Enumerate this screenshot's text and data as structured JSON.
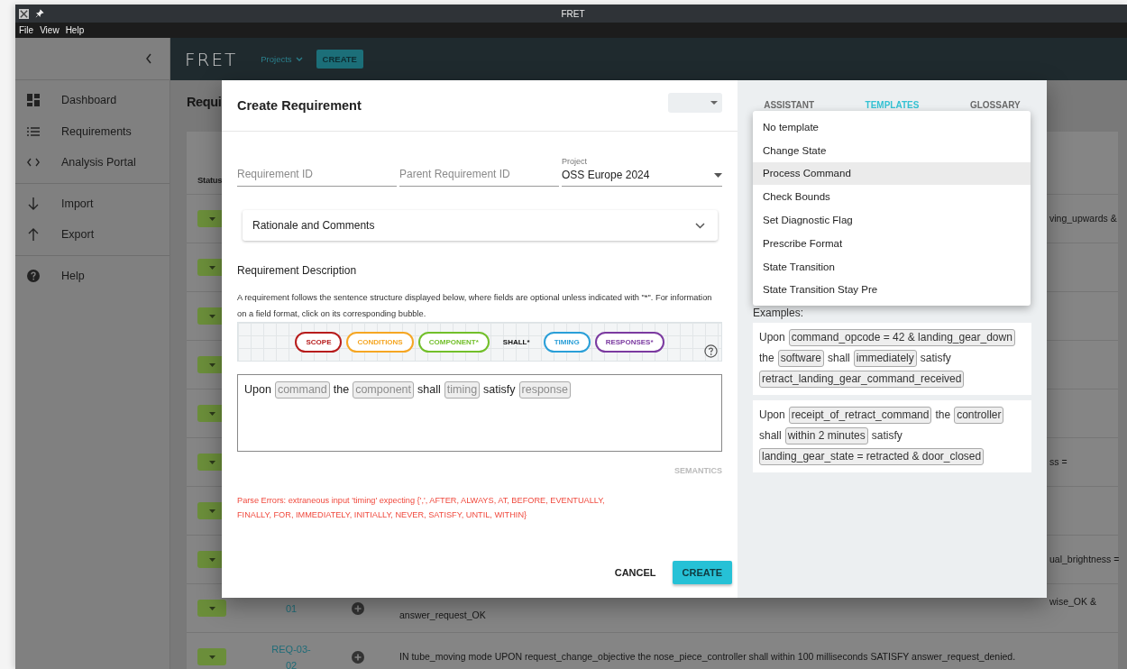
{
  "window": {
    "title": "FRET"
  },
  "menu_bar": [
    {
      "label": "File"
    },
    {
      "label": "View"
    },
    {
      "label": "Help"
    }
  ],
  "sidebar": {
    "groups": [
      {
        "items": [
          {
            "label": "Dashboard"
          },
          {
            "label": "Requirements"
          },
          {
            "label": "Analysis Portal"
          }
        ]
      },
      {
        "items": [
          {
            "label": "Import"
          },
          {
            "label": "Export"
          }
        ]
      },
      {
        "items": [
          {
            "label": "Help"
          }
        ]
      }
    ]
  },
  "app_bar": {
    "logo": "FRET",
    "projects": "Projects",
    "create": "CREATE"
  },
  "page": {
    "title": "Requi",
    "table": {
      "columns": [
        {
          "label": "Status"
        }
      ],
      "rows": [
        {
          "kind": "partly_covered",
          "peek": "ving_upwards &"
        },
        {
          "kind": "covered"
        },
        {
          "kind": "covered"
        },
        {
          "kind": "covered"
        },
        {
          "kind": "covered"
        },
        {
          "kind": "partly_covered",
          "peek": "ss ="
        },
        {
          "kind": "covered"
        },
        {
          "kind": "partly_covered",
          "peek": "ual_brightness ="
        },
        {
          "kind": "partly_covered",
          "id": "01",
          "peek": "wise_OK &",
          "text": "answer_request_OK"
        },
        {
          "kind": "visible",
          "id": "REQ-03-02",
          "text": "IN tube_moving mode UPON request_change_objective the nose_piece_controller shall within 100 milliseconds SATISFY answer_request_denied."
        }
      ]
    }
  },
  "dialog": {
    "title": "Create Requirement",
    "fields": [
      {
        "placeholder": "Requirement ID"
      },
      {
        "placeholder": "Parent Requirement ID"
      }
    ],
    "project": {
      "label": "Project",
      "value": "OSS Europe 2024"
    },
    "rationale": {
      "label": "Rationale and Comments",
      "expanded": false
    },
    "description": {
      "heading": "Requirement Description",
      "help": "A requirement follows the sentence structure displayed below, where fields are optional unless indicated with \"*\". For information on a field format, click on its corresponding bubble.",
      "bubbles": [
        {
          "label": "SCOPE",
          "kind": "bubble",
          "color": "#b71c1c"
        },
        {
          "label": "CONDITIONS",
          "kind": "bubble",
          "color": "#f5a623"
        },
        {
          "label": "COMPONENT*",
          "kind": "bubble",
          "color": "#72bf2a"
        },
        {
          "label": "SHALL*",
          "kind": "plain"
        },
        {
          "label": "TIMING",
          "kind": "bubble",
          "color": "#2a9fd8"
        },
        {
          "label": "RESPONSES*",
          "kind": "bubble",
          "color": "#7b3aa0"
        }
      ]
    },
    "editor": {
      "parts": [
        {
          "text": "Upon",
          "kind": "word"
        },
        {
          "text": "command",
          "kind": "placeholder"
        },
        {
          "text": "the",
          "kind": "word"
        },
        {
          "text": "component",
          "kind": "placeholder"
        },
        {
          "text": "shall",
          "kind": "word"
        },
        {
          "text": "timing",
          "kind": "placeholder"
        },
        {
          "text": "satisfy",
          "kind": "word"
        },
        {
          "text": "response",
          "kind": "placeholder"
        }
      ]
    },
    "semantics": {
      "label": "SEMANTICS",
      "disabled": true
    },
    "parse_error": "Parse Errors: extraneous input 'timing' expecting {',', AFTER, ALWAYS, AT, BEFORE, EVENTUALLY, FINALLY, FOR, IMMEDIATELY, INITIALLY, NEVER, SATISFY, UNTIL, WITHIN}",
    "buttons": [
      {
        "label": "CANCEL",
        "kind": "text"
      },
      {
        "label": "CREATE",
        "kind": "primary"
      }
    ]
  },
  "assistant": {
    "tabs": [
      {
        "label": "ASSISTANT",
        "selected": false
      },
      {
        "label": "TEMPLATES",
        "selected": true
      },
      {
        "label": "GLOSSARY",
        "selected": false
      }
    ],
    "examples_label": "Examples:",
    "examples": [
      {
        "parts": [
          {
            "text": "Upon",
            "kind": "word"
          },
          {
            "text": "command_opcode = 42 & landing_gear_down",
            "kind": "field"
          },
          {
            "text": "the",
            "kind": "word"
          },
          {
            "text": "software",
            "kind": "field"
          },
          {
            "text": "shall",
            "kind": "word"
          },
          {
            "text": "immediately",
            "kind": "field"
          },
          {
            "text": "satisfy",
            "kind": "word"
          },
          {
            "text": "retract_landing_gear_command_received",
            "kind": "field"
          }
        ]
      },
      {
        "parts": [
          {
            "text": "Upon",
            "kind": "word"
          },
          {
            "text": "receipt_of_retract_command",
            "kind": "field"
          },
          {
            "text": "the",
            "kind": "word"
          },
          {
            "text": "controller",
            "kind": "field"
          },
          {
            "text": "shall",
            "kind": "word"
          },
          {
            "text": "within 2 minutes",
            "kind": "field"
          },
          {
            "text": "satisfy",
            "kind": "word"
          },
          {
            "text": "landing_gear_state = retracted & door_closed",
            "kind": "field"
          }
        ]
      }
    ]
  },
  "template_menu": {
    "items": [
      {
        "label": "No template",
        "selected": false
      },
      {
        "label": "Change State",
        "selected": false
      },
      {
        "label": "Process Command",
        "selected": true
      },
      {
        "label": "Check Bounds",
        "selected": false
      },
      {
        "label": "Set Diagnostic Flag",
        "selected": false
      },
      {
        "label": "Prescribe Format",
        "selected": false
      },
      {
        "label": "State Transition",
        "selected": false
      },
      {
        "label": "State Transition Stay Pre",
        "selected": false
      }
    ]
  }
}
